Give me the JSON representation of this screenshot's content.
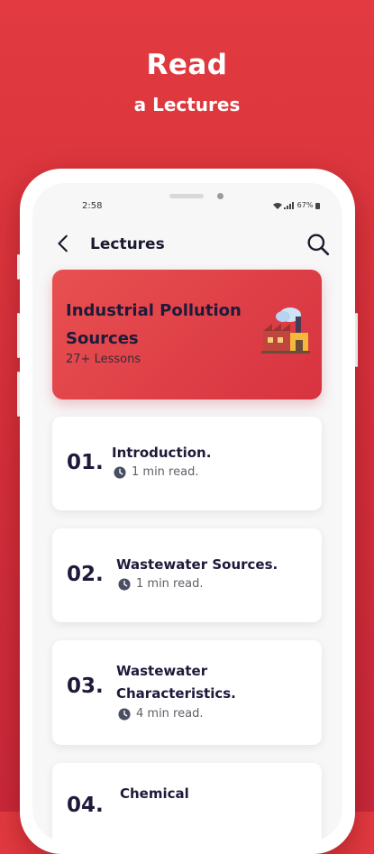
{
  "hero": {
    "title": "Read",
    "subtitle": "a Lectures"
  },
  "status_bar": {
    "time": "2:58",
    "battery": "67%"
  },
  "header": {
    "title": "Lectures"
  },
  "banner": {
    "title": "Industrial Pollution Sources",
    "count": "27+ Lessons"
  },
  "lectures": [
    {
      "num": "01.",
      "title": "Introduction.",
      "read": "1 min read."
    },
    {
      "num": "02.",
      "title": "Wastewater Sources.",
      "read": "1 min read."
    },
    {
      "num": "03.",
      "title": "Wastewater Characteristics.",
      "read": "4 min read."
    },
    {
      "num": "04.",
      "title": "Chemical"
    }
  ],
  "colors": {
    "accent": "#d73340",
    "text_dark": "#1d1a3a"
  },
  "icons": [
    "back-arrow-icon",
    "search-icon",
    "factory-icon",
    "clock-icon"
  ]
}
